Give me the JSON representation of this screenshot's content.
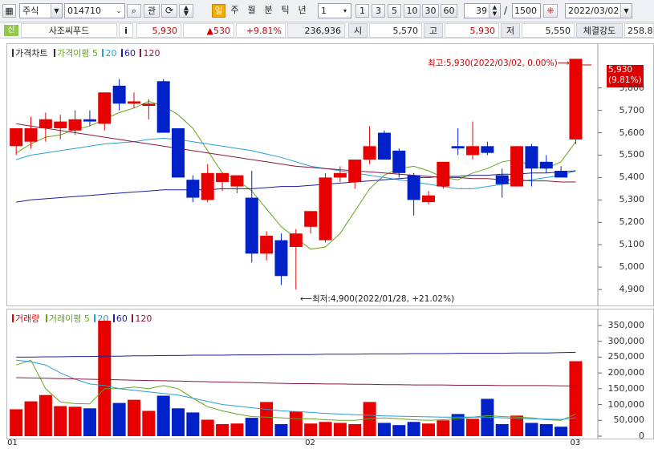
{
  "toolbar": {
    "market_select": "주식",
    "code_input": "014710",
    "search_btn": "⌕",
    "gwan_btn": "관",
    "period_buttons": [
      "일",
      "주",
      "월",
      "분",
      "틱",
      "년"
    ],
    "interval_select": "1",
    "interval_buttons": [
      "1",
      "3",
      "5",
      "10",
      "30",
      "60"
    ],
    "count_value": "39",
    "total_value": "1500",
    "date_value": "2022/03/02"
  },
  "quote": {
    "badge": "신",
    "name": "사조씨푸드",
    "info_btn": "i",
    "price": "5,930",
    "change": "▲530",
    "change_rate": "+9.81%",
    "volume": "236,936",
    "open_label": "시",
    "open_value": "5,570",
    "high_label": "고",
    "high_value": "5,930",
    "low_label": "저",
    "low_value": "5,550",
    "strength_label": "체결강도",
    "strength_value": "258.8"
  },
  "price_pane": {
    "legend_price": "가격차트",
    "legend_ma_label": "가격이평",
    "legend_ma_periods": [
      "5",
      "20",
      "60",
      "120"
    ],
    "high_annotation": "최고:5,930(2022/03/02, 0.00%)⟶",
    "low_annotation": "⟵최저:4,900(2022/01/28, +21.02%)",
    "current_price_tag": "5,930",
    "current_rate_tag": "(9.81%)",
    "y_ticks": [
      "5,800",
      "5,700",
      "5,600",
      "5,500",
      "5,400",
      "5,300",
      "5,200",
      "5,100",
      "5,000",
      "4,900"
    ]
  },
  "volume_pane": {
    "legend_volume": "거래량",
    "legend_ma_label": "거래이평",
    "legend_ma_periods": [
      "5",
      "20",
      "60",
      "120"
    ],
    "y_ticks": [
      "350,000",
      "300,000",
      "250,000",
      "200,000",
      "150,000",
      "100,000",
      "50,000",
      "0"
    ],
    "x_ticks": [
      "01",
      "02",
      "03"
    ]
  },
  "colors": {
    "up": "#e60000",
    "down": "#0020c8",
    "ma5": "#66a61e",
    "ma20": "#2a9fd6",
    "ma60": "#1f1fa0",
    "ma120": "#8b1a3a"
  },
  "chart_data": {
    "type": "candlestick",
    "price_ylim": [
      4850,
      5960
    ],
    "volume_ylim": [
      0,
      370000
    ],
    "x_ticks": [
      "01",
      "02",
      "03"
    ],
    "candles": [
      {
        "o": 5540,
        "h": 5580,
        "l": 5500,
        "c": 5620
      },
      {
        "o": 5560,
        "h": 5670,
        "l": 5530,
        "c": 5620
      },
      {
        "o": 5620,
        "h": 5690,
        "l": 5560,
        "c": 5660
      },
      {
        "o": 5620,
        "h": 5680,
        "l": 5570,
        "c": 5650
      },
      {
        "o": 5610,
        "h": 5700,
        "l": 5590,
        "c": 5660
      },
      {
        "o": 5660,
        "h": 5700,
        "l": 5630,
        "c": 5650
      },
      {
        "o": 5640,
        "h": 5780,
        "l": 5610,
        "c": 5780
      },
      {
        "o": 5810,
        "h": 5840,
        "l": 5700,
        "c": 5730
      },
      {
        "o": 5730,
        "h": 5780,
        "l": 5710,
        "c": 5740
      },
      {
        "o": 5720,
        "h": 5750,
        "l": 5660,
        "c": 5730
      },
      {
        "o": 5830,
        "h": 5840,
        "l": 5600,
        "c": 5600
      },
      {
        "o": 5620,
        "h": 5620,
        "l": 5400,
        "c": 5400
      },
      {
        "o": 5390,
        "h": 5410,
        "l": 5290,
        "c": 5310
      },
      {
        "o": 5300,
        "h": 5460,
        "l": 5290,
        "c": 5420
      },
      {
        "o": 5380,
        "h": 5420,
        "l": 5340,
        "c": 5420
      },
      {
        "o": 5360,
        "h": 5380,
        "l": 5330,
        "c": 5410
      },
      {
        "o": 5310,
        "h": 5430,
        "l": 5020,
        "c": 5060
      },
      {
        "o": 5060,
        "h": 5160,
        "l": 5030,
        "c": 5140
      },
      {
        "o": 5120,
        "h": 5150,
        "l": 4920,
        "c": 4960
      },
      {
        "o": 5090,
        "h": 5170,
        "l": 4900,
        "c": 5150
      },
      {
        "o": 5180,
        "h": 5230,
        "l": 5150,
        "c": 5250
      },
      {
        "o": 5120,
        "h": 5420,
        "l": 5110,
        "c": 5400
      },
      {
        "o": 5400,
        "h": 5450,
        "l": 5380,
        "c": 5420
      },
      {
        "o": 5380,
        "h": 5480,
        "l": 5350,
        "c": 5480
      },
      {
        "o": 5480,
        "h": 5630,
        "l": 5460,
        "c": 5540
      },
      {
        "o": 5600,
        "h": 5610,
        "l": 5480,
        "c": 5480
      },
      {
        "o": 5520,
        "h": 5530,
        "l": 5400,
        "c": 5420
      },
      {
        "o": 5410,
        "h": 5420,
        "l": 5230,
        "c": 5300
      },
      {
        "o": 5290,
        "h": 5340,
        "l": 5280,
        "c": 5320
      },
      {
        "o": 5360,
        "h": 5470,
        "l": 5350,
        "c": 5470
      },
      {
        "o": 5540,
        "h": 5620,
        "l": 5500,
        "c": 5530
      },
      {
        "o": 5500,
        "h": 5650,
        "l": 5480,
        "c": 5540
      },
      {
        "o": 5540,
        "h": 5560,
        "l": 5500,
        "c": 5510
      },
      {
        "o": 5410,
        "h": 5440,
        "l": 5310,
        "c": 5370
      },
      {
        "o": 5360,
        "h": 5540,
        "l": 5360,
        "c": 5540
      },
      {
        "o": 5540,
        "h": 5550,
        "l": 5360,
        "c": 5440
      },
      {
        "o": 5470,
        "h": 5500,
        "l": 5420,
        "c": 5440
      },
      {
        "o": 5430,
        "h": 5450,
        "l": 5400,
        "c": 5400
      },
      {
        "o": 5570,
        "h": 5930,
        "l": 5550,
        "c": 5930
      }
    ],
    "volume": [
      85000,
      110000,
      130000,
      95000,
      93000,
      88000,
      365000,
      105000,
      115000,
      80000,
      128000,
      88000,
      75000,
      52000,
      38000,
      40000,
      58000,
      108000,
      38000,
      78000,
      40000,
      45000,
      42000,
      38000,
      108000,
      42000,
      35000,
      45000,
      40000,
      50000,
      70000,
      55000,
      118000,
      38000,
      65000,
      42000,
      38000,
      30000,
      236936
    ],
    "ma_price": [
      {
        "name": "5",
        "values": [
          5510,
          5550,
          5580,
          5590,
          5615,
          5630,
          5660,
          5690,
          5710,
          5740,
          5720,
          5680,
          5620,
          5520,
          5420,
          5390,
          5340,
          5260,
          5180,
          5130,
          5080,
          5090,
          5150,
          5250,
          5350,
          5410,
          5440,
          5450,
          5430,
          5400,
          5390,
          5420,
          5440,
          5470,
          5480,
          5450,
          5440,
          5470,
          5560
        ]
      },
      {
        "name": "20",
        "values": [
          5480,
          5500,
          5510,
          5520,
          5530,
          5540,
          5550,
          5555,
          5560,
          5570,
          5575,
          5570,
          5560,
          5550,
          5540,
          5530,
          5520,
          5505,
          5490,
          5470,
          5450,
          5440,
          5430,
          5420,
          5410,
          5400,
          5390,
          5380,
          5370,
          5360,
          5350,
          5350,
          5360,
          5370,
          5380,
          5390,
          5400,
          5410,
          5430
        ]
      },
      {
        "name": "60",
        "values": [
          5290,
          5300,
          5305,
          5310,
          5315,
          5320,
          5325,
          5330,
          5335,
          5340,
          5345,
          5345,
          5345,
          5345,
          5350,
          5350,
          5350,
          5355,
          5360,
          5360,
          5365,
          5370,
          5375,
          5380,
          5385,
          5390,
          5395,
          5400,
          5400,
          5405,
          5405,
          5410,
          5410,
          5415,
          5415,
          5420,
          5420,
          5425,
          5430
        ]
      },
      {
        "name": "120",
        "values": [
          5640,
          5630,
          5620,
          5610,
          5600,
          5590,
          5580,
          5570,
          5560,
          5550,
          5540,
          5530,
          5520,
          5510,
          5500,
          5490,
          5480,
          5470,
          5460,
          5450,
          5445,
          5440,
          5435,
          5430,
          5425,
          5420,
          5415,
          5410,
          5405,
          5400,
          5400,
          5395,
          5395,
          5390,
          5390,
          5385,
          5385,
          5380,
          5380
        ]
      }
    ],
    "ma_volume": [
      {
        "name": "5",
        "values": [
          225000,
          240000,
          150000,
          108000,
          103000,
          102000,
          150000,
          150000,
          155000,
          150000,
          160000,
          150000,
          120000,
          93000,
          80000,
          70000,
          62000,
          60000,
          58000,
          55000,
          55000,
          52000,
          50000,
          50000,
          55000,
          58000,
          55000,
          52000,
          50000,
          52000,
          55000,
          60000,
          65000,
          62000,
          60000,
          58000,
          52000,
          50000,
          70000
        ]
      },
      {
        "name": "20",
        "values": [
          240000,
          235000,
          225000,
          200000,
          180000,
          165000,
          160000,
          150000,
          145000,
          140000,
          135000,
          130000,
          120000,
          110000,
          100000,
          95000,
          90000,
          85000,
          80000,
          78000,
          75000,
          72000,
          70000,
          68000,
          66000,
          64000,
          63000,
          62000,
          61000,
          60000,
          60000,
          60000,
          60000,
          58000,
          56000,
          55000,
          54000,
          53000,
          58000
        ]
      },
      {
        "name": "60",
        "values": [
          250000,
          250000,
          251000,
          251000,
          252000,
          252000,
          253000,
          253000,
          254000,
          254000,
          255000,
          255000,
          256000,
          256000,
          256000,
          257000,
          257000,
          257000,
          258000,
          258000,
          258000,
          259000,
          259000,
          259000,
          260000,
          260000,
          260000,
          261000,
          261000,
          261000,
          262000,
          262000,
          262000,
          262000,
          263000,
          263000,
          263000,
          264000,
          265000
        ]
      },
      {
        "name": "120",
        "values": [
          185000,
          184000,
          183000,
          182000,
          181000,
          180000,
          179000,
          178000,
          177000,
          176000,
          175000,
          174000,
          173000,
          172000,
          171000,
          170000,
          169000,
          168000,
          167000,
          166000,
          166000,
          165000,
          165000,
          164000,
          164000,
          163000,
          163000,
          162000,
          162000,
          162000,
          161000,
          161000,
          161000,
          160000,
          160000,
          160000,
          160000,
          159000,
          159000
        ]
      }
    ]
  }
}
